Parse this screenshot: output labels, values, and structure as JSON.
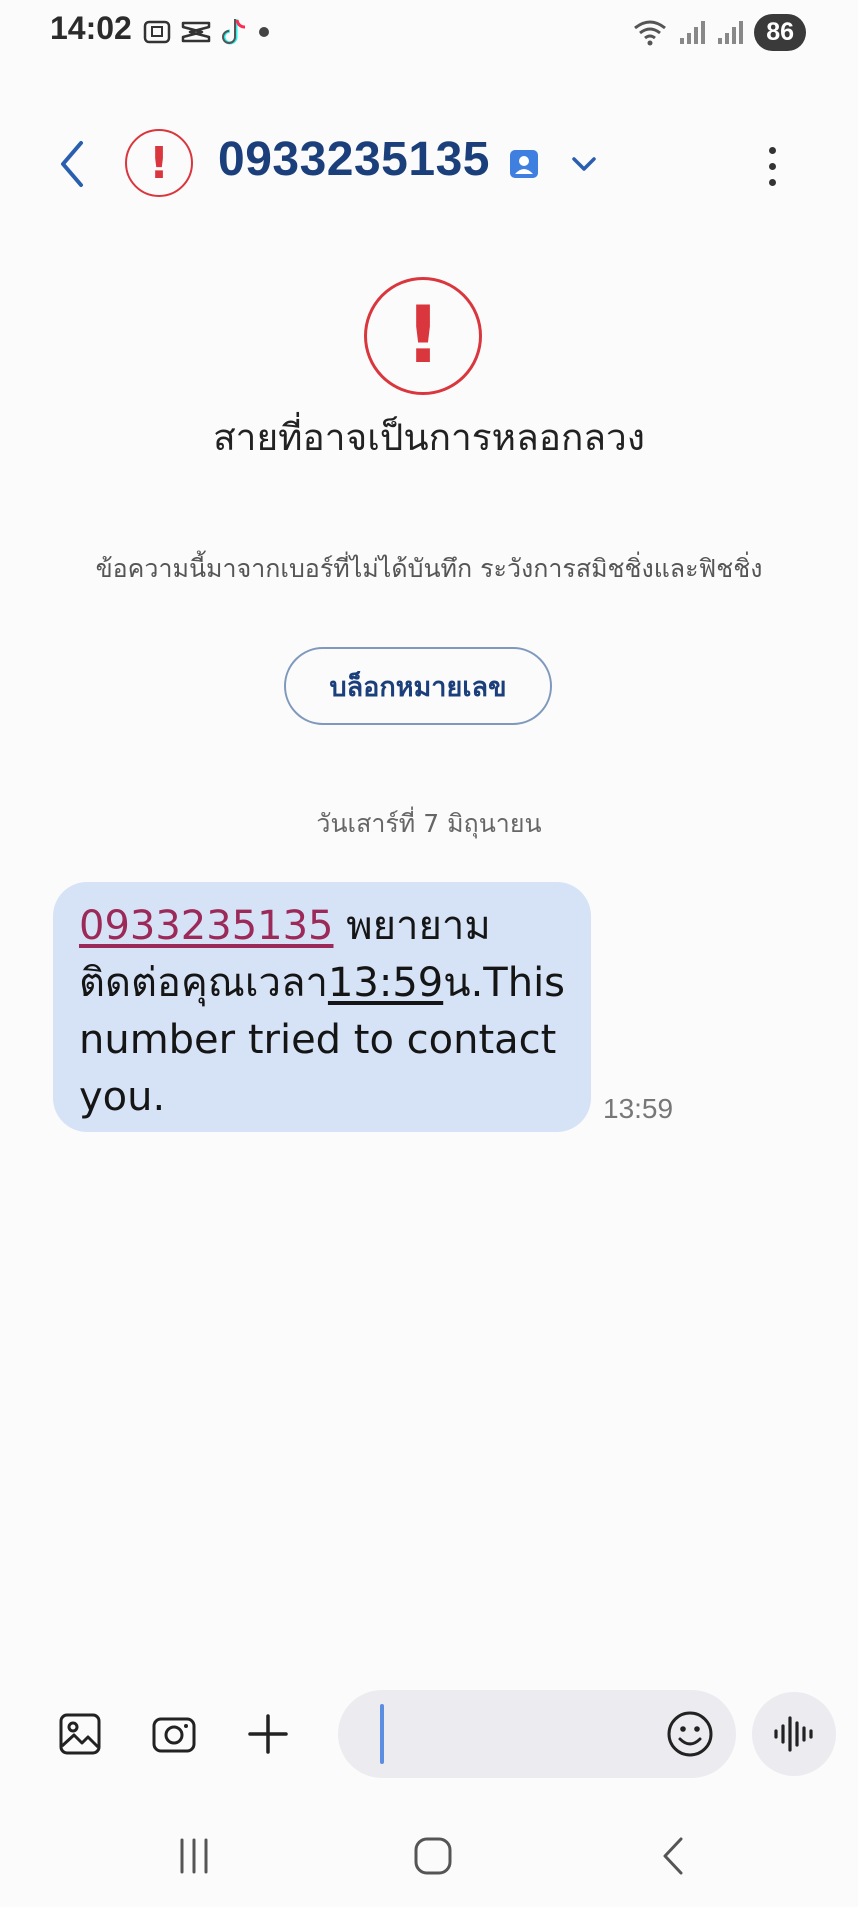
{
  "status_bar": {
    "time": "14:02",
    "battery": "86",
    "icons_left": [
      "screenshot-icon",
      "capcut-icon",
      "tiktok-icon",
      "dot-icon"
    ],
    "icons_right": [
      "wifi-icon",
      "signal-icon",
      "signal-icon-2"
    ]
  },
  "header": {
    "title": "0933235135",
    "back_icon": "back-arrow-icon",
    "warning_icon": "warning-icon",
    "contact_icon": "contact-card-icon",
    "expand_icon": "chevron-down-icon",
    "menu_icon": "more-vert-icon"
  },
  "warning": {
    "title": "สายที่อาจเป็นการหลอกลวง",
    "description": "ข้อความนี้มาจากเบอร์ที่ไม่ได้บันทึก ระวังการสมิชชิ่งและฟิชชิ่ง",
    "block_button": "บล็อกหมายเลข"
  },
  "conversation": {
    "date": "วันเสาร์ที่ 7 มิถุนายน",
    "messages": [
      {
        "link_number": "0933235135",
        "text_1": " พยายามติดต่อคุณเวลา",
        "link_time": "13:59",
        "text_2": "น.This number tried to contact you.",
        "time": "13:59"
      }
    ]
  },
  "compose": {
    "placeholder": "",
    "value": "",
    "buttons": [
      "gallery-icon",
      "camera-icon",
      "plus-icon",
      "emoji-icon",
      "voice-icon"
    ]
  },
  "nav_bar": {
    "buttons": [
      "recents-icon",
      "home-icon",
      "back-icon"
    ]
  },
  "colors": {
    "accent": "#1b3f7b",
    "warning": "#d9363e",
    "bubble": "#d6e3f7",
    "link": "#9c2a58"
  }
}
